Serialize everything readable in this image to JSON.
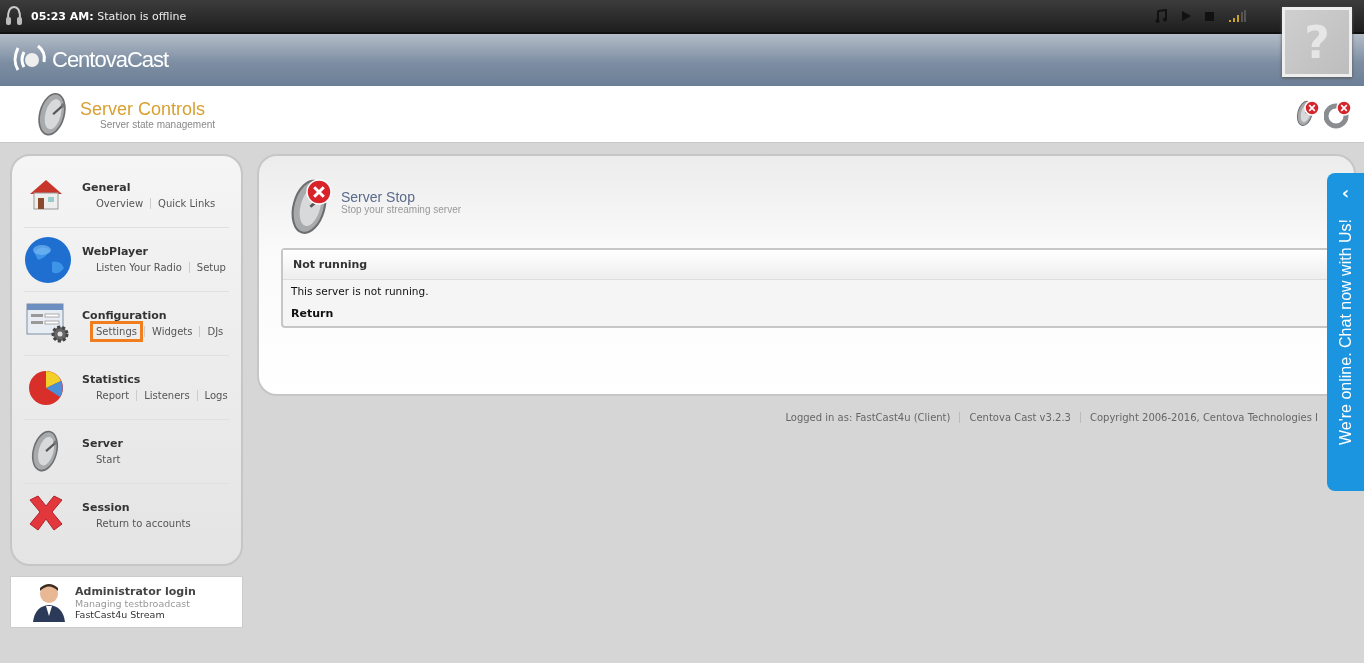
{
  "top_bar": {
    "time": "05:23 AM:",
    "status": "Station is offline"
  },
  "header": {
    "logo": "CentovaCast",
    "help": "?"
  },
  "page_title": {
    "title": "Server Controls",
    "subtitle": "Server state management"
  },
  "sidebar": {
    "sections": [
      {
        "kind": "home",
        "title": "General",
        "links": [
          {
            "label": "Overview",
            "highlighted": false
          },
          {
            "label": "Quick Links",
            "highlighted": false
          }
        ]
      },
      {
        "kind": "globe",
        "title": "WebPlayer",
        "links": [
          {
            "label": "Listen Your Radio",
            "highlighted": false
          },
          {
            "label": "Setup",
            "highlighted": false
          }
        ]
      },
      {
        "kind": "config",
        "title": "Configuration",
        "links": [
          {
            "label": "Settings",
            "highlighted": true
          },
          {
            "label": "Widgets",
            "highlighted": false
          },
          {
            "label": "DJs",
            "highlighted": false
          }
        ]
      },
      {
        "kind": "chart",
        "title": "Statistics",
        "links": [
          {
            "label": "Report",
            "highlighted": false
          },
          {
            "label": "Listeners",
            "highlighted": false
          },
          {
            "label": "Logs",
            "highlighted": false
          }
        ]
      },
      {
        "kind": "dish",
        "title": "Server",
        "links": [
          {
            "label": "Start",
            "highlighted": false
          }
        ]
      },
      {
        "kind": "cross",
        "title": "Session",
        "links": [
          {
            "label": "Return to accounts",
            "highlighted": false
          }
        ]
      }
    ]
  },
  "admin": {
    "title": "Administrator login",
    "line1": "Managing testbroadcast",
    "line2": "FastCast4u Stream"
  },
  "panel": {
    "title": "Server Stop",
    "subtitle": "Stop your streaming server",
    "box_heading": "Not running",
    "message": "This server is not running.",
    "link": "Return"
  },
  "footer": [
    "Logged in as: FastCast4u (Client)",
    "Centova Cast v3.2.3",
    "Copyright 2006-2016, Centova Technologies I"
  ],
  "chat_tab": {
    "arrow": "‹",
    "label": "We're online. Chat now with Us!"
  }
}
